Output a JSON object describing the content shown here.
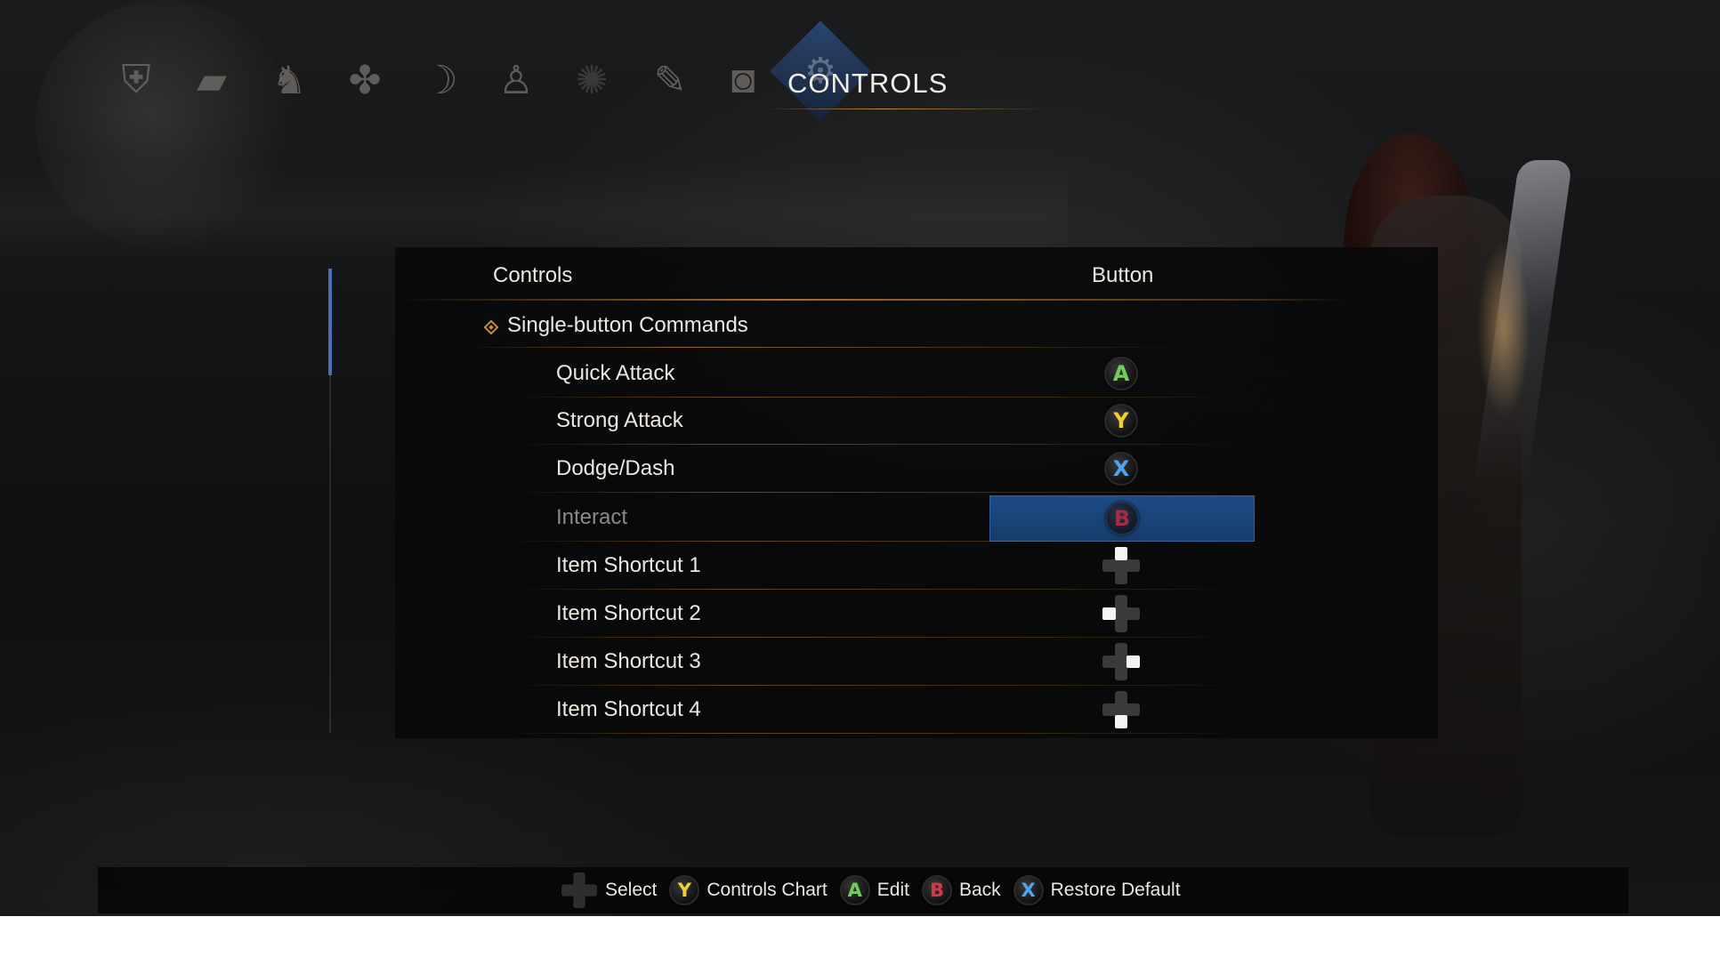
{
  "screen": {
    "title": "CONTROLS"
  },
  "nav": {
    "icons": [
      "helmet-icon",
      "scroll-icon",
      "beast-icon",
      "amulet-icon",
      "bow-icon",
      "character-icon",
      "dragon-icon",
      "brush-icon",
      "camera-icon",
      "gear-icon"
    ]
  },
  "table": {
    "header_controls": "Controls",
    "header_button": "Button",
    "category": "Single-button Commands",
    "rows": [
      {
        "label": "Quick Attack",
        "button": "A"
      },
      {
        "label": "Strong Attack",
        "button": "Y"
      },
      {
        "label": "Dodge/Dash",
        "button": "X"
      },
      {
        "label": "Interact",
        "button": "B",
        "selected": true
      },
      {
        "label": "Item Shortcut 1",
        "button": "dpad-up"
      },
      {
        "label": "Item Shortcut 2",
        "button": "dpad-left"
      },
      {
        "label": "Item Shortcut 3",
        "button": "dpad-right"
      },
      {
        "label": "Item Shortcut 4",
        "button": "dpad-down"
      }
    ]
  },
  "hints": [
    {
      "button": "dpad",
      "label": "Select"
    },
    {
      "button": "Y",
      "label": "Controls Chart"
    },
    {
      "button": "A",
      "label": "Edit"
    },
    {
      "button": "B",
      "label": "Back"
    },
    {
      "button": "X",
      "label": "Restore Default"
    }
  ],
  "colors": {
    "accent_blue": "#1d4b87",
    "button_A": "#6fcf5a",
    "button_Y": "#f2cf35",
    "button_X": "#4da5f0",
    "button_B": "#d23a4a",
    "gold_line": "#c98c3c"
  }
}
